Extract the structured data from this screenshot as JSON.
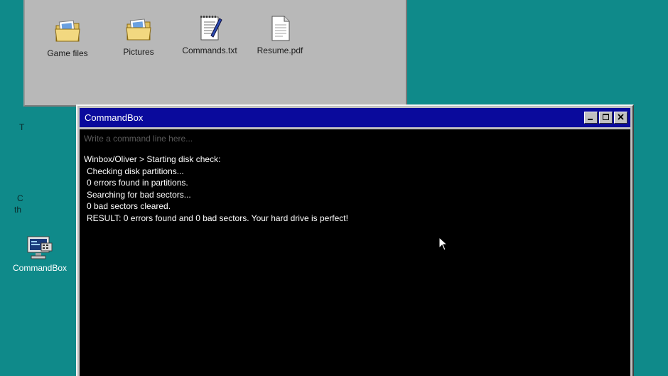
{
  "desktop": {
    "partial_labels": [
      "T",
      "C",
      "th"
    ],
    "icons": [
      {
        "label": "CommandBox",
        "icon": "terminal-computer-icon"
      }
    ]
  },
  "explorer": {
    "files": [
      {
        "label": "Game files",
        "icon": "folder-icon"
      },
      {
        "label": "Pictures",
        "icon": "folder-icon"
      },
      {
        "label": "Commands.txt",
        "icon": "text-document-icon"
      },
      {
        "label": "Resume.pdf",
        "icon": "document-icon"
      }
    ]
  },
  "commandbox": {
    "title": "CommandBox",
    "input_placeholder": "Write a command line here...",
    "input_value": "",
    "output": [
      "Winbox/Oliver > Starting disk check:",
      "Checking disk partitions...",
      "0 errors found in partitions.",
      "Searching for bad sectors...",
      "0 bad sectors cleared.",
      "RESULT: 0 errors found and 0 bad sectors. Your hard drive is perfect!"
    ],
    "controls": [
      "minimize",
      "maximize",
      "close"
    ]
  },
  "colors": {
    "desktop": "#0f8a8a",
    "titlebar": "#0a0a9c",
    "console_bg": "#000000",
    "window_grey": "#c0c0c0"
  }
}
